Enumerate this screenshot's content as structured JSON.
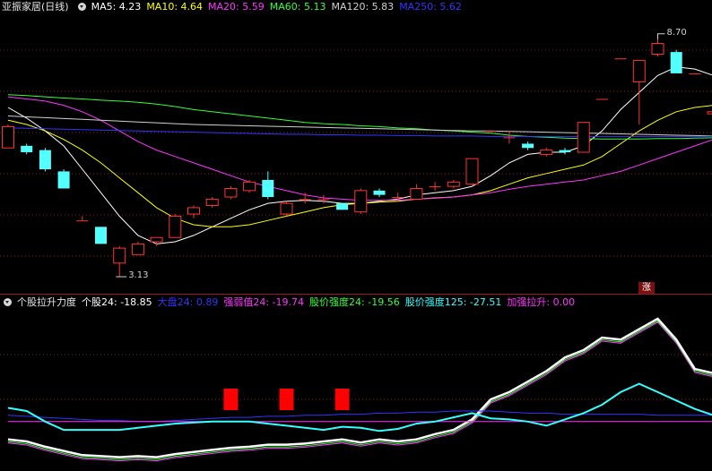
{
  "main_panel": {
    "title": "亚振家居(日线)",
    "indicators": [
      {
        "label": "MA5: 4.23",
        "color": "#ffffff"
      },
      {
        "label": "MA10: 4.64",
        "color": "#ffff00"
      },
      {
        "label": "MA20: 5.59",
        "color": "#ff33ff"
      },
      {
        "label": "MA60: 5.13",
        "color": "#33ff33"
      },
      {
        "label": "MA120: 5.83",
        "color": "#d0d0d0"
      },
      {
        "label": "MA250: 5.62",
        "color": "#3333ff"
      }
    ],
    "high_label": "8.70",
    "low_label": "3.13",
    "badge": "涨"
  },
  "sub_panel": {
    "title": "个股拉升力度",
    "indicators": [
      {
        "label": "个股24: -18.85",
        "color": "#ffffff"
      },
      {
        "label": "大盘24: 0.89",
        "color": "#3333ff"
      },
      {
        "label": "强弱值24: -19.74",
        "color": "#ff33ff"
      },
      {
        "label": "股价强度24: -19.56",
        "color": "#33ff33"
      },
      {
        "label": "股价强度125: -27.51",
        "color": "#33ffff"
      },
      {
        "label": "加强拉升: 0.00",
        "color": "#ff33ff"
      }
    ]
  },
  "chart_data": {
    "type": "candlestick",
    "candles": [
      {
        "o": 6.15,
        "c": 6.65,
        "h": 6.7,
        "l": 6.15
      },
      {
        "o": 6.2,
        "c": 6.05,
        "h": 6.25,
        "l": 6.0
      },
      {
        "o": 6.1,
        "c": 5.65,
        "h": 6.15,
        "l": 5.6
      },
      {
        "o": 5.6,
        "c": 5.2,
        "h": 5.65,
        "l": 5.2
      },
      {
        "o": 4.45,
        "c": 4.45,
        "h": 4.55,
        "l": 4.45
      },
      {
        "o": 4.3,
        "c": 3.9,
        "h": 4.3,
        "l": 3.9
      },
      {
        "o": 3.45,
        "c": 3.8,
        "h": 3.85,
        "l": 3.13
      },
      {
        "o": 3.65,
        "c": 3.9,
        "h": 3.95,
        "l": 3.65
      },
      {
        "o": 3.95,
        "c": 4.05,
        "h": 4.05,
        "l": 3.85
      },
      {
        "o": 4.05,
        "c": 4.55,
        "h": 4.6,
        "l": 4.05
      },
      {
        "o": 4.6,
        "c": 4.75,
        "h": 4.8,
        "l": 4.5
      },
      {
        "o": 4.8,
        "c": 4.95,
        "h": 5.0,
        "l": 4.75
      },
      {
        "o": 5.0,
        "c": 5.2,
        "h": 5.25,
        "l": 4.95
      },
      {
        "o": 5.15,
        "c": 5.35,
        "h": 5.4,
        "l": 5.1
      },
      {
        "o": 5.4,
        "c": 5.0,
        "h": 5.6,
        "l": 4.95
      },
      {
        "o": 4.6,
        "c": 4.85,
        "h": 4.9,
        "l": 4.55
      },
      {
        "o": 4.95,
        "c": 4.95,
        "h": 5.1,
        "l": 4.85
      },
      {
        "o": 4.95,
        "c": 4.95,
        "h": 5.05,
        "l": 4.85
      },
      {
        "o": 4.85,
        "c": 4.7,
        "h": 4.85,
        "l": 4.7
      },
      {
        "o": 4.65,
        "c": 5.15,
        "h": 5.2,
        "l": 4.6
      },
      {
        "o": 5.15,
        "c": 5.05,
        "h": 5.2,
        "l": 5.0
      },
      {
        "o": 5.0,
        "c": 5.0,
        "h": 5.1,
        "l": 4.9
      },
      {
        "o": 4.95,
        "c": 5.2,
        "h": 5.3,
        "l": 4.95
      },
      {
        "o": 5.25,
        "c": 5.25,
        "h": 5.35,
        "l": 5.15
      },
      {
        "o": 5.25,
        "c": 5.35,
        "h": 5.4,
        "l": 5.2
      },
      {
        "o": 5.3,
        "c": 5.9,
        "h": 5.9,
        "l": 5.25
      },
      {
        "o": 6.55,
        "c": 6.55,
        "h": 6.55,
        "l": 6.55
      },
      {
        "o": 6.4,
        "c": 6.4,
        "h": 6.55,
        "l": 6.25
      },
      {
        "o": 6.25,
        "c": 6.15,
        "h": 6.3,
        "l": 6.1
      },
      {
        "o": 6.0,
        "c": 6.1,
        "h": 6.15,
        "l": 5.95
      },
      {
        "o": 6.1,
        "c": 6.05,
        "h": 6.15,
        "l": 6.0
      },
      {
        "o": 6.05,
        "c": 6.75,
        "h": 6.75,
        "l": 6.05
      },
      {
        "o": 7.3,
        "c": 7.3,
        "h": 7.3,
        "l": 7.3
      },
      {
        "o": 8.25,
        "c": 8.25,
        "h": 8.25,
        "l": 8.25
      },
      {
        "o": 7.7,
        "c": 8.2,
        "h": 8.2,
        "l": 6.7
      },
      {
        "o": 8.35,
        "c": 8.6,
        "h": 8.7,
        "l": 8.3
      },
      {
        "o": 8.4,
        "c": 7.9,
        "h": 8.45,
        "l": 7.9
      },
      {
        "o": 7.9,
        "c": 7.9,
        "h": 7.9,
        "l": 7.9
      },
      {
        "o": 6.95,
        "c": 7.0,
        "h": 7.0,
        "l": 6.95
      },
      {
        "o": 7.15,
        "c": 6.75,
        "h": 7.35,
        "l": 6.75
      }
    ],
    "ma_series": [
      {
        "name": "MA5",
        "values": [
          7.1,
          6.85,
          6.55,
          6.2,
          5.65,
          5.1,
          4.55,
          4.1,
          3.9,
          3.95,
          4.1,
          4.3,
          4.5,
          4.7,
          4.85,
          4.9,
          4.92,
          4.9,
          4.85,
          4.85,
          4.9,
          4.95,
          5.05,
          5.1,
          5.15,
          5.25,
          5.5,
          5.8,
          6.0,
          6.05,
          6.05,
          6.2,
          6.55,
          7.05,
          7.45,
          7.85,
          8.05,
          8.0,
          7.85,
          7.7
        ]
      },
      {
        "name": "MA10",
        "values": [
          6.8,
          6.7,
          6.55,
          6.35,
          6.1,
          5.8,
          5.45,
          5.1,
          4.75,
          4.5,
          4.35,
          4.3,
          4.3,
          4.35,
          4.45,
          4.55,
          4.65,
          4.75,
          4.82,
          4.85,
          4.88,
          4.9,
          4.95,
          4.98,
          5.0,
          5.05,
          5.15,
          5.3,
          5.45,
          5.55,
          5.65,
          5.75,
          5.95,
          6.25,
          6.55,
          6.8,
          7.0,
          7.1,
          7.15,
          7.15
        ]
      },
      {
        "name": "MA20",
        "values": [
          7.35,
          7.3,
          7.25,
          7.15,
          7.0,
          6.8,
          6.55,
          6.3,
          6.1,
          5.95,
          5.8,
          5.65,
          5.5,
          5.35,
          5.25,
          5.15,
          5.05,
          4.98,
          4.95,
          4.92,
          4.92,
          4.92,
          4.95,
          4.97,
          5.0,
          5.05,
          5.1,
          5.18,
          5.25,
          5.3,
          5.35,
          5.4,
          5.5,
          5.6,
          5.75,
          5.9,
          6.05,
          6.2,
          6.35,
          6.45
        ]
      },
      {
        "name": "MA60",
        "values": [
          7.4,
          7.38,
          7.35,
          7.32,
          7.3,
          7.27,
          7.25,
          7.22,
          7.18,
          7.12,
          7.05,
          7.0,
          6.95,
          6.9,
          6.85,
          6.8,
          6.75,
          6.72,
          6.7,
          6.67,
          6.65,
          6.62,
          6.6,
          6.57,
          6.55,
          6.52,
          6.5,
          6.45,
          6.42,
          6.4,
          6.38,
          6.37,
          6.36,
          6.36,
          6.36,
          6.37,
          6.37,
          6.38,
          6.39,
          6.4
        ]
      },
      {
        "name": "MA120",
        "values": [
          6.9,
          6.88,
          6.86,
          6.84,
          6.82,
          6.8,
          6.78,
          6.76,
          6.74,
          6.72,
          6.7,
          6.69,
          6.68,
          6.67,
          6.66,
          6.65,
          6.64,
          6.63,
          6.62,
          6.61,
          6.6,
          6.59,
          6.58,
          6.57,
          6.56,
          6.55,
          6.55,
          6.54,
          6.53,
          6.52,
          6.51,
          6.5,
          6.49,
          6.48,
          6.47,
          6.46,
          6.45,
          6.44,
          6.43,
          6.42
        ]
      },
      {
        "name": "MA250",
        "values": [
          6.62,
          6.61,
          6.6,
          6.59,
          6.58,
          6.57,
          6.56,
          6.55,
          6.54,
          6.53,
          6.52,
          6.51,
          6.5,
          6.49,
          6.48,
          6.47,
          6.47,
          6.46,
          6.46,
          6.45,
          6.45,
          6.44,
          6.44,
          6.43,
          6.43,
          6.43,
          6.42,
          6.42,
          6.42,
          6.42,
          6.42,
          6.42,
          6.42,
          6.42,
          6.42,
          6.42,
          6.42,
          6.42,
          6.42,
          6.42
        ]
      }
    ],
    "sub_series": [
      {
        "name": "个股24",
        "values": [
          -75,
          -77,
          -82,
          -86,
          -90,
          -91,
          -92,
          -91,
          -92,
          -89,
          -87,
          -85,
          -83,
          -82,
          -80,
          -80,
          -79,
          -77,
          -75,
          -78,
          -75,
          -77,
          -75,
          -70,
          -66,
          -56,
          -37,
          -30,
          -20,
          -10,
          3,
          10,
          22,
          20,
          30,
          40,
          20,
          -8,
          -12,
          -15
        ]
      },
      {
        "name": "大盘24",
        "values": [
          -52,
          -53,
          -54,
          -55,
          -56,
          -57,
          -57,
          -58,
          -58,
          -57,
          -56,
          -55,
          -54,
          -54,
          -53,
          -53,
          -52,
          -52,
          -51,
          -51,
          -50,
          -50,
          -49,
          -49,
          -48,
          -48,
          -48,
          -49,
          -50,
          -50,
          -51,
          -51,
          -51,
          -51,
          -51,
          -52,
          -52,
          -52,
          -52,
          -52
        ]
      },
      {
        "name": "强弱值24",
        "values": [
          -58,
          -58,
          -58,
          -58,
          -58,
          -58,
          -58,
          -58,
          -58,
          -58,
          -58,
          -58,
          -58,
          -58,
          -58,
          -58,
          -58,
          -58,
          -58,
          -58,
          -58,
          -58,
          -58,
          -58,
          -58,
          -58,
          -58,
          -58,
          -58,
          -58,
          -58,
          -58,
          -58,
          -58,
          -58,
          -58,
          -58,
          -58,
          -58,
          -58
        ]
      },
      {
        "name": "股价强度125",
        "values": [
          -45,
          -48,
          -58,
          -66,
          -66,
          -66,
          -66,
          -64,
          -62,
          -60,
          -59,
          -58,
          -58,
          -58,
          -60,
          -62,
          -64,
          -66,
          -63,
          -64,
          -67,
          -65,
          -60,
          -58,
          -54,
          -50,
          -55,
          -56,
          -58,
          -62,
          -56,
          -50,
          -42,
          -30,
          -22,
          -30,
          -38,
          -46,
          -52,
          -52
        ]
      }
    ],
    "boost_bars": [
      12,
      15,
      18
    ],
    "ylim_main": [
      2.9,
      9.2
    ],
    "ylim_sub": [
      -100,
      45
    ]
  }
}
